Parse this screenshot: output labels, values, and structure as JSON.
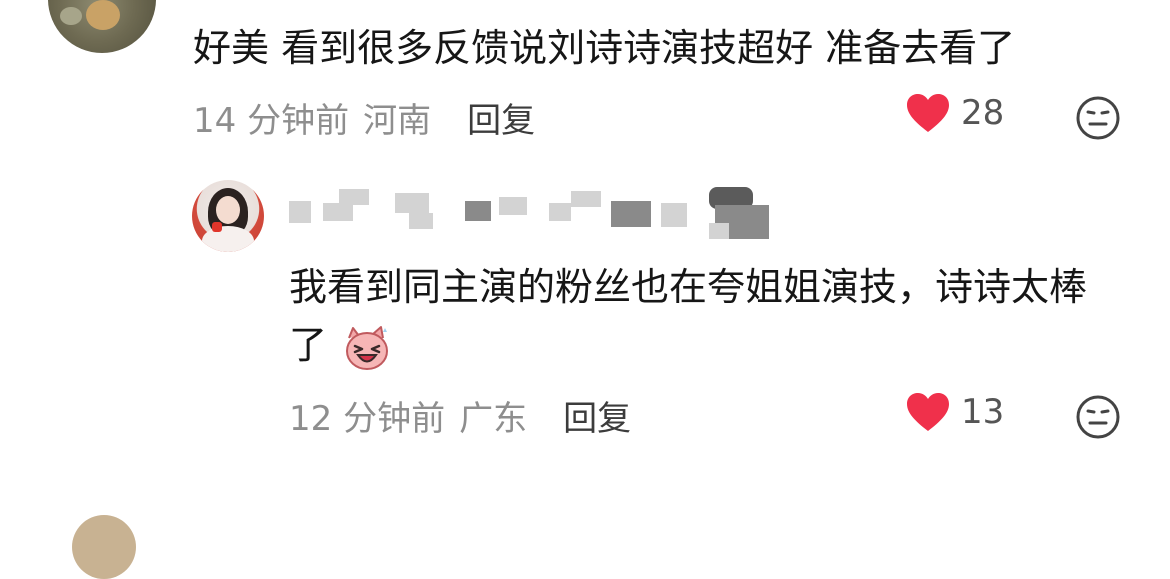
{
  "comments": [
    {
      "text": "好美 看到很多反馈说刘诗诗演技超好 准备去看了",
      "time": "14 分钟前",
      "region": "河南",
      "reply_label": "回复",
      "likes": "28"
    },
    {
      "text": "我看到同主演的粉丝也在夸姐姐演技，诗诗太棒了",
      "time": "12 分钟前",
      "region": "广东",
      "reply_label": "回复",
      "likes": "13"
    }
  ],
  "colors": {
    "heart": "#f0304b",
    "meta_gray": "#8e8e8e",
    "text": "#161616"
  },
  "icons": {
    "like": "heart-icon",
    "dislike": "neutral-face-icon",
    "sticker": "laughing-sticker-icon"
  }
}
